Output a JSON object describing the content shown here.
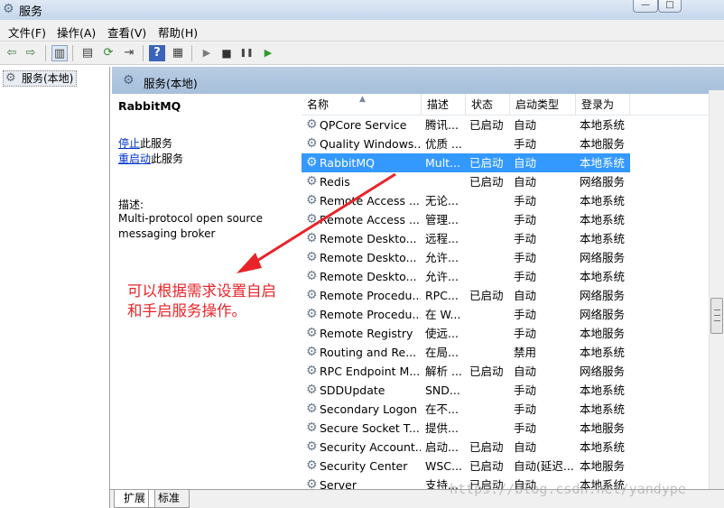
{
  "window": {
    "title": "服务",
    "title_icon": "gear-icon",
    "min_label": "—",
    "max_label": "□"
  },
  "menu": {
    "items": [
      "文件(F)",
      "操作(A)",
      "查看(V)",
      "帮助(H)"
    ]
  },
  "toolbar": {
    "buttons": [
      "back-icon",
      "forward-icon",
      "show-hide-tree-icon",
      "properties-icon",
      "refresh-icon",
      "export-icon",
      "help-icon",
      "console-icon",
      "start-icon",
      "stop-icon",
      "pause-icon",
      "restart-icon"
    ],
    "glyphs": {
      "back": "⇦",
      "forward": "⇨",
      "tree": "▥",
      "props": "▤",
      "refresh": "⟳",
      "export": "⇥",
      "help": "?",
      "console": "▦",
      "start": "▶",
      "stop": "■",
      "pause": "❚❚",
      "restart": "▶"
    }
  },
  "tree": {
    "node_label": "服务(本地)"
  },
  "pane": {
    "header": "服务(本地)",
    "service_name": "RabbitMQ",
    "stop_link": "停止",
    "stop_suffix": "此服务",
    "restart_link": "重启动",
    "restart_suffix": "此服务",
    "desc_label": "描述:",
    "desc_line1": "Multi-protocol open source",
    "desc_line2": "messaging broker"
  },
  "list": {
    "columns": [
      "名称",
      "描述",
      "状态",
      "启动类型",
      "登录为"
    ],
    "rows": [
      [
        "QPCore Service",
        "腾讯...",
        "已启动",
        "自动",
        "本地系统"
      ],
      [
        "Quality Windows...",
        "优质 ...",
        "",
        "手动",
        "本地服务"
      ],
      [
        "RabbitMQ",
        "Mult...",
        "已启动",
        "自动",
        "本地系统"
      ],
      [
        "Redis",
        "",
        "已启动",
        "自动",
        "网络服务"
      ],
      [
        "Remote Access ...",
        "无论...",
        "",
        "手动",
        "本地系统"
      ],
      [
        "Remote Access ...",
        "管理...",
        "",
        "手动",
        "本地系统"
      ],
      [
        "Remote Deskto...",
        "远程...",
        "",
        "手动",
        "本地系统"
      ],
      [
        "Remote Deskto...",
        "允许...",
        "",
        "手动",
        "网络服务"
      ],
      [
        "Remote Deskto...",
        "允许...",
        "",
        "手动",
        "本地系统"
      ],
      [
        "Remote Procedu...",
        "RPC...",
        "已启动",
        "自动",
        "网络服务"
      ],
      [
        "Remote Procedu...",
        "在 W...",
        "",
        "手动",
        "网络服务"
      ],
      [
        "Remote Registry",
        "使远...",
        "",
        "手动",
        "本地服务"
      ],
      [
        "Routing and Re...",
        "在局...",
        "",
        "禁用",
        "本地系统"
      ],
      [
        "RPC Endpoint M...",
        "解析 ...",
        "已启动",
        "自动",
        "网络服务"
      ],
      [
        "SDDUpdate",
        "SND...",
        "",
        "手动",
        "本地系统"
      ],
      [
        "Secondary Logon",
        "在不...",
        "",
        "手动",
        "本地系统"
      ],
      [
        "Secure Socket T...",
        "提供...",
        "",
        "手动",
        "本地服务"
      ],
      [
        "Security Account...",
        "启动...",
        "已启动",
        "自动",
        "本地系统"
      ],
      [
        "Security Center",
        "WSC...",
        "已启动",
        "自动(延迟...",
        "本地服务"
      ],
      [
        "Server",
        "支持...",
        "已启动",
        "自动",
        "本地系统"
      ]
    ],
    "selected_index": 2,
    "row_icon": "service-gear-icon"
  },
  "tabs": [
    "扩展",
    "标准"
  ],
  "annotation": {
    "line1": "可以根据需求设置自启",
    "line2": "和手启服务操作。",
    "color": "#e8242a"
  },
  "watermark": "https://blog.csdn.net/yandype"
}
